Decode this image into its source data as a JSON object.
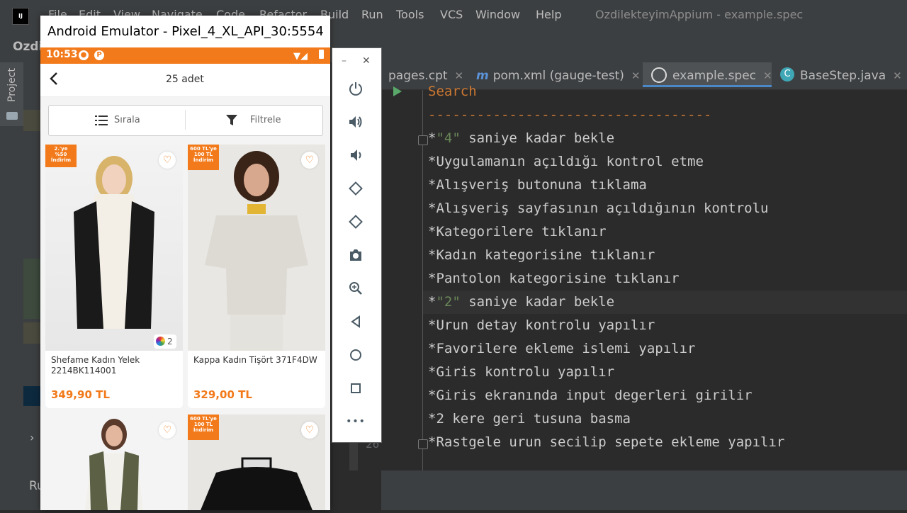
{
  "ide": {
    "logo": "IJ",
    "menu": [
      "File",
      "Edit",
      "View",
      "Navigate",
      "Code",
      "Refactor",
      "Build",
      "Run",
      "Tools",
      "VCS",
      "Window",
      "Help"
    ],
    "title": "OzdilekteyimAppium - example.spec",
    "project_name": "Ozdi",
    "project_tab": "Project",
    "run_tab": "Ru"
  },
  "tabs": [
    {
      "label": "pages.cpt",
      "icon": "cpt-file-icon"
    },
    {
      "label": "pom.xml (gauge-test)",
      "icon": "maven-icon"
    },
    {
      "label": "example.spec",
      "icon": "gauge-spec-icon"
    },
    {
      "label": "BaseStep.java",
      "icon": "java-class-icon"
    }
  ],
  "editor": {
    "heading": "Search",
    "underline": "-----------------------------------",
    "line_number": "26",
    "lines": [
      {
        "prefix": "*",
        "param": "\"4\"",
        "text": " saniye kadar bekle"
      },
      {
        "prefix": "*",
        "text": "Uygulamanın açıldığı kontrol etme"
      },
      {
        "prefix": "*",
        "text": "Alışveriş butonuna tıklama"
      },
      {
        "prefix": "*",
        "text": "Alışveriş sayfasının açıldığının kontrolu"
      },
      {
        "prefix": "*",
        "text": "Kategorilere tıklanır"
      },
      {
        "prefix": "*",
        "text": "Kadın kategorisine tıklanır"
      },
      {
        "prefix": "*",
        "text": "Pantolon kategorisine tıklanır"
      },
      {
        "prefix": "*",
        "param": "\"2\"",
        "text": " saniye kadar bekle"
      },
      {
        "prefix": "*",
        "text": "Urun detay kontrolu yapılır"
      },
      {
        "prefix": "*",
        "text": "Favorilere ekleme islemi yapılır"
      },
      {
        "prefix": "*",
        "text": "Giris kontrolu yapılır"
      },
      {
        "prefix": "*",
        "text": "Giris ekranında input degerleri girilir"
      },
      {
        "prefix": "*",
        "text": "2 kere geri tusuna basma"
      },
      {
        "prefix": "*",
        "text": "Rastgele urun secilip sepete ekleme yapılır"
      }
    ]
  },
  "emulator": {
    "title": "Android Emulator - Pixel_4_XL_API_30:5554",
    "status_time": "10:53",
    "page_title": "25 adet",
    "sort_label": "Sırala",
    "filter_label": "Filtrele",
    "products": [
      {
        "badge": "2.'ye %50 İndirim",
        "name": "Shefame Kadın Yelek 2214BK114001",
        "price": "349,90 TL",
        "color_count": "2"
      },
      {
        "badge": "600 TL'ye 100 TL İndirim",
        "name": "Kappa Kadın Tişört 371F4DW",
        "price": "329,00 TL"
      },
      {
        "badge": "",
        "name": "",
        "price": ""
      },
      {
        "badge": "600 TL'ye 100 TL İndirim",
        "name": "",
        "price": ""
      }
    ],
    "toolbar": [
      "power-icon",
      "volume-up-icon",
      "volume-down-icon",
      "rotate-left-icon",
      "rotate-right-icon",
      "camera-icon",
      "zoom-icon",
      "back-icon",
      "home-icon",
      "overview-icon",
      "more-icon"
    ]
  },
  "colors": {
    "brand_orange": "#f27a1a",
    "ide_bg": "#2b2b2b",
    "heading": "#cc7832",
    "string": "#6a8759"
  }
}
